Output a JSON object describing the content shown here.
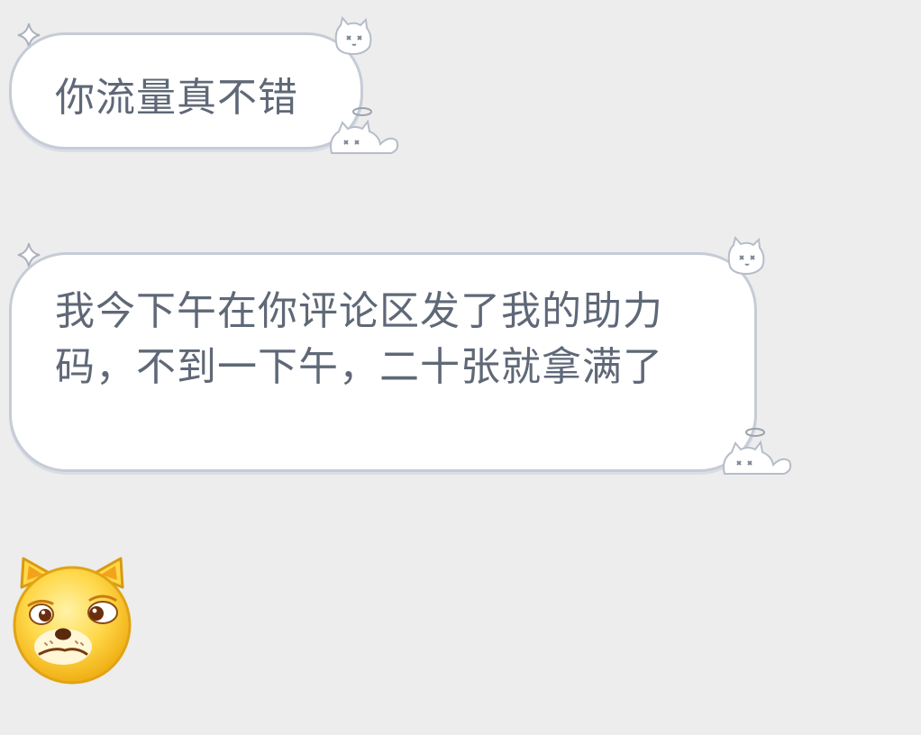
{
  "messages": [
    {
      "text": "你流量真不错"
    },
    {
      "text": "我今下午在你评论区发了我的助力码，不到一下午，二十张就拿满了"
    }
  ],
  "emoji": {
    "icon": "doge-emoji-icon"
  },
  "colors": {
    "background": "#ededed",
    "bubble_fill": "#ffffff",
    "bubble_border": "#c6ccd6",
    "text": "#5f6877"
  }
}
